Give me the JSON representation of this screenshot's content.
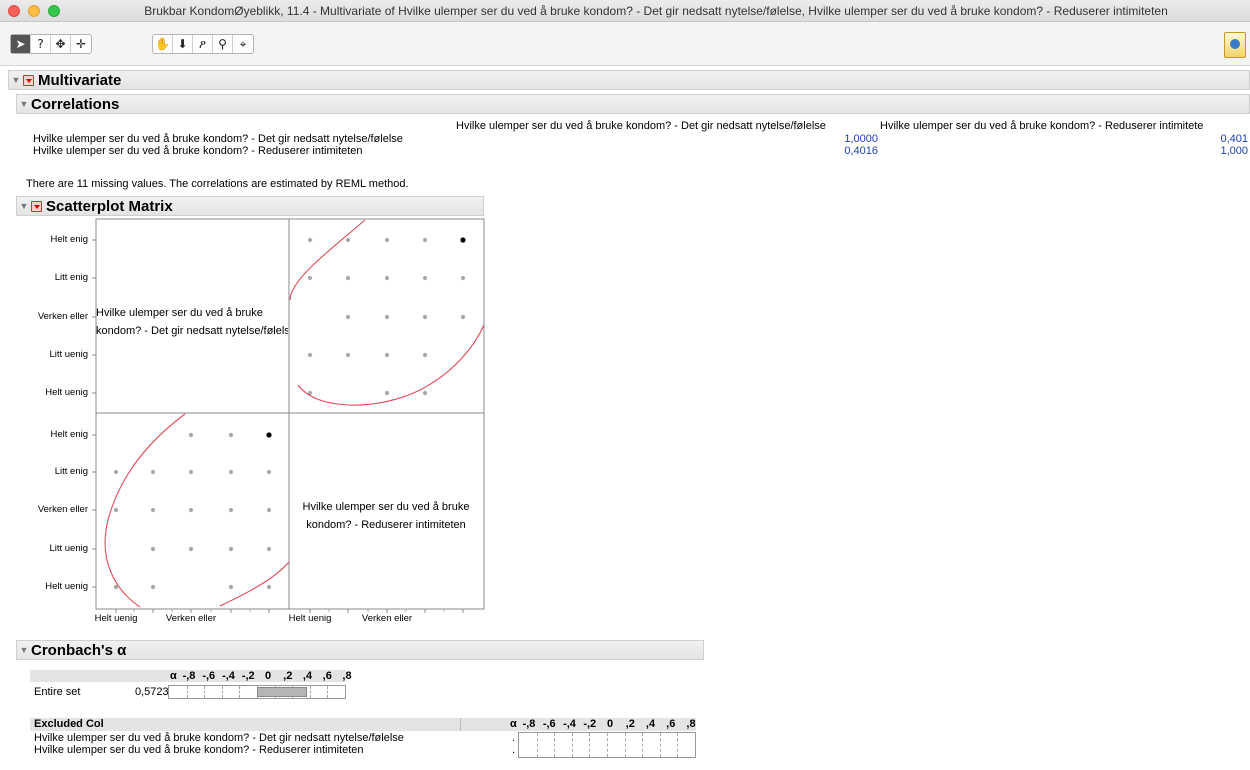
{
  "window": {
    "title": "Brukbar KondomØyeblikk, 11.4 - Multivariate of Hvilke ulemper ser du ved å bruke kondom? - Det gir nedsatt nytelse/følelse, Hvilke ulemper ser du ved å bruke kondom? - Reduserer intimiteten"
  },
  "toolbar": {
    "tools": [
      {
        "name": "arrow",
        "glyph": "➤"
      },
      {
        "name": "help",
        "glyph": "?"
      },
      {
        "name": "selection",
        "glyph": "✥"
      },
      {
        "name": "crosshair",
        "glyph": "✛"
      },
      {
        "name": "grabber",
        "glyph": "✋"
      },
      {
        "name": "brush",
        "glyph": "⬇"
      },
      {
        "name": "lasso",
        "glyph": "ዖ"
      },
      {
        "name": "magnifier",
        "glyph": "⚲"
      },
      {
        "name": "annotate",
        "glyph": "⌖"
      }
    ]
  },
  "multivariate": {
    "title": "Multivariate"
  },
  "correlations": {
    "title": "Correlations",
    "columns": [
      "Hvilke ulemper ser du ved å bruke kondom? - Det gir nedsatt nytelse/følelse",
      "Hvilke ulemper ser du ved å bruke kondom? - Reduserer intimitete"
    ],
    "rows": [
      {
        "label": "Hvilke ulemper ser du ved å bruke kondom? - Det gir nedsatt nytelse/følelse",
        "values": [
          "1,0000",
          "0,401"
        ]
      },
      {
        "label": "Hvilke ulemper ser du ved å bruke kondom? - Reduserer intimiteten",
        "values": [
          "0,4016",
          "1,000"
        ]
      }
    ],
    "note": "There are 11 missing values. The correlations are estimated by REML method."
  },
  "scatterplot": {
    "title": "Scatterplot Matrix",
    "y_ticks": [
      "Helt enig",
      "Litt enig",
      "Verken eller",
      "Litt uenig",
      "Helt uenig"
    ],
    "x_ticks": [
      "Helt uenig",
      "Verken eller",
      "Helt uenig",
      "Verken eller"
    ],
    "diag_label_1": "Hvilke ulemper ser du ved å bruke\nkondom? - Det gir nedsatt nytelse/følelse",
    "diag_label_2": "Hvilke ulemper ser du ved å bruke\nkondom? - Reduserer intimiteten",
    "colors": {
      "point": "#a8a8a8",
      "highlight": "#000000",
      "ellipse": "#e04a5a"
    }
  },
  "chart_data": {
    "type": "scatter",
    "title": "Scatterplot Matrix",
    "categories": [
      "Helt uenig",
      "Litt uenig",
      "Verken eller",
      "Litt enig",
      "Helt enig"
    ],
    "panels": [
      {
        "panel": "top-right",
        "x": "Reduserer intimiteten",
        "y": "Det gir nedsatt nytelse/følelse",
        "points": [
          [
            "Helt uenig",
            "Helt enig"
          ],
          [
            "Litt uenig",
            "Helt enig"
          ],
          [
            "Verken eller",
            "Helt enig"
          ],
          [
            "Litt enig",
            "Helt enig"
          ],
          [
            "Helt enig",
            "Helt enig"
          ],
          [
            "Helt uenig",
            "Litt enig"
          ],
          [
            "Litt uenig",
            "Litt enig"
          ],
          [
            "Verken eller",
            "Litt enig"
          ],
          [
            "Litt enig",
            "Litt enig"
          ],
          [
            "Helt enig",
            "Litt enig"
          ],
          [
            "Litt uenig",
            "Verken eller"
          ],
          [
            "Verken eller",
            "Verken eller"
          ],
          [
            "Litt enig",
            "Verken eller"
          ],
          [
            "Helt enig",
            "Verken eller"
          ],
          [
            "Helt uenig",
            "Litt uenig"
          ],
          [
            "Litt uenig",
            "Litt uenig"
          ],
          [
            "Verken eller",
            "Litt uenig"
          ],
          [
            "Litt enig",
            "Litt uenig"
          ],
          [
            "Helt uenig",
            "Helt uenig"
          ],
          [
            "Verken eller",
            "Helt uenig"
          ],
          [
            "Litt enig",
            "Helt uenig"
          ]
        ],
        "highlight": [
          "Helt enig",
          "Helt enig"
        ]
      },
      {
        "panel": "bottom-left",
        "x": "Det gir nedsatt nytelse/følelse",
        "y": "Reduserer intimiteten",
        "points": [
          [
            "Verken eller",
            "Helt enig"
          ],
          [
            "Litt enig",
            "Helt enig"
          ],
          [
            "Helt enig",
            "Helt enig"
          ],
          [
            "Helt uenig",
            "Litt enig"
          ],
          [
            "Litt uenig",
            "Litt enig"
          ],
          [
            "Verken eller",
            "Litt enig"
          ],
          [
            "Litt enig",
            "Litt enig"
          ],
          [
            "Helt enig",
            "Litt enig"
          ],
          [
            "Helt uenig",
            "Verken eller"
          ],
          [
            "Litt uenig",
            "Verken eller"
          ],
          [
            "Verken eller",
            "Verken eller"
          ],
          [
            "Litt enig",
            "Verken eller"
          ],
          [
            "Helt enig",
            "Verken eller"
          ],
          [
            "Litt uenig",
            "Litt uenig"
          ],
          [
            "Verken eller",
            "Litt uenig"
          ],
          [
            "Litt enig",
            "Litt uenig"
          ],
          [
            "Helt enig",
            "Litt uenig"
          ],
          [
            "Helt uenig",
            "Helt uenig"
          ],
          [
            "Litt uenig",
            "Helt uenig"
          ],
          [
            "Litt enig",
            "Helt uenig"
          ],
          [
            "Helt enig",
            "Helt uenig"
          ]
        ],
        "highlight": [
          "Helt enig",
          "Helt enig"
        ]
      }
    ]
  },
  "cronbach": {
    "title": "Cronbach's α",
    "alpha_symbol": "α",
    "scale_labels": [
      "-,8",
      "-,6",
      "-,4",
      "-,2",
      "0",
      ",2",
      ",4",
      ",6",
      ",8"
    ],
    "entire_label": "Entire set",
    "entire_value": "0,5723",
    "entire_alpha": 0.5723,
    "excluded_header": "Excluded Col",
    "excluded_rows": [
      {
        "label": "Hvilke ulemper ser du ved å bruke kondom? - Det gir nedsatt nytelse/følelse",
        "value": "."
      },
      {
        "label": "Hvilke ulemper ser du ved å bruke kondom? - Reduserer intimiteten",
        "value": "."
      }
    ]
  }
}
